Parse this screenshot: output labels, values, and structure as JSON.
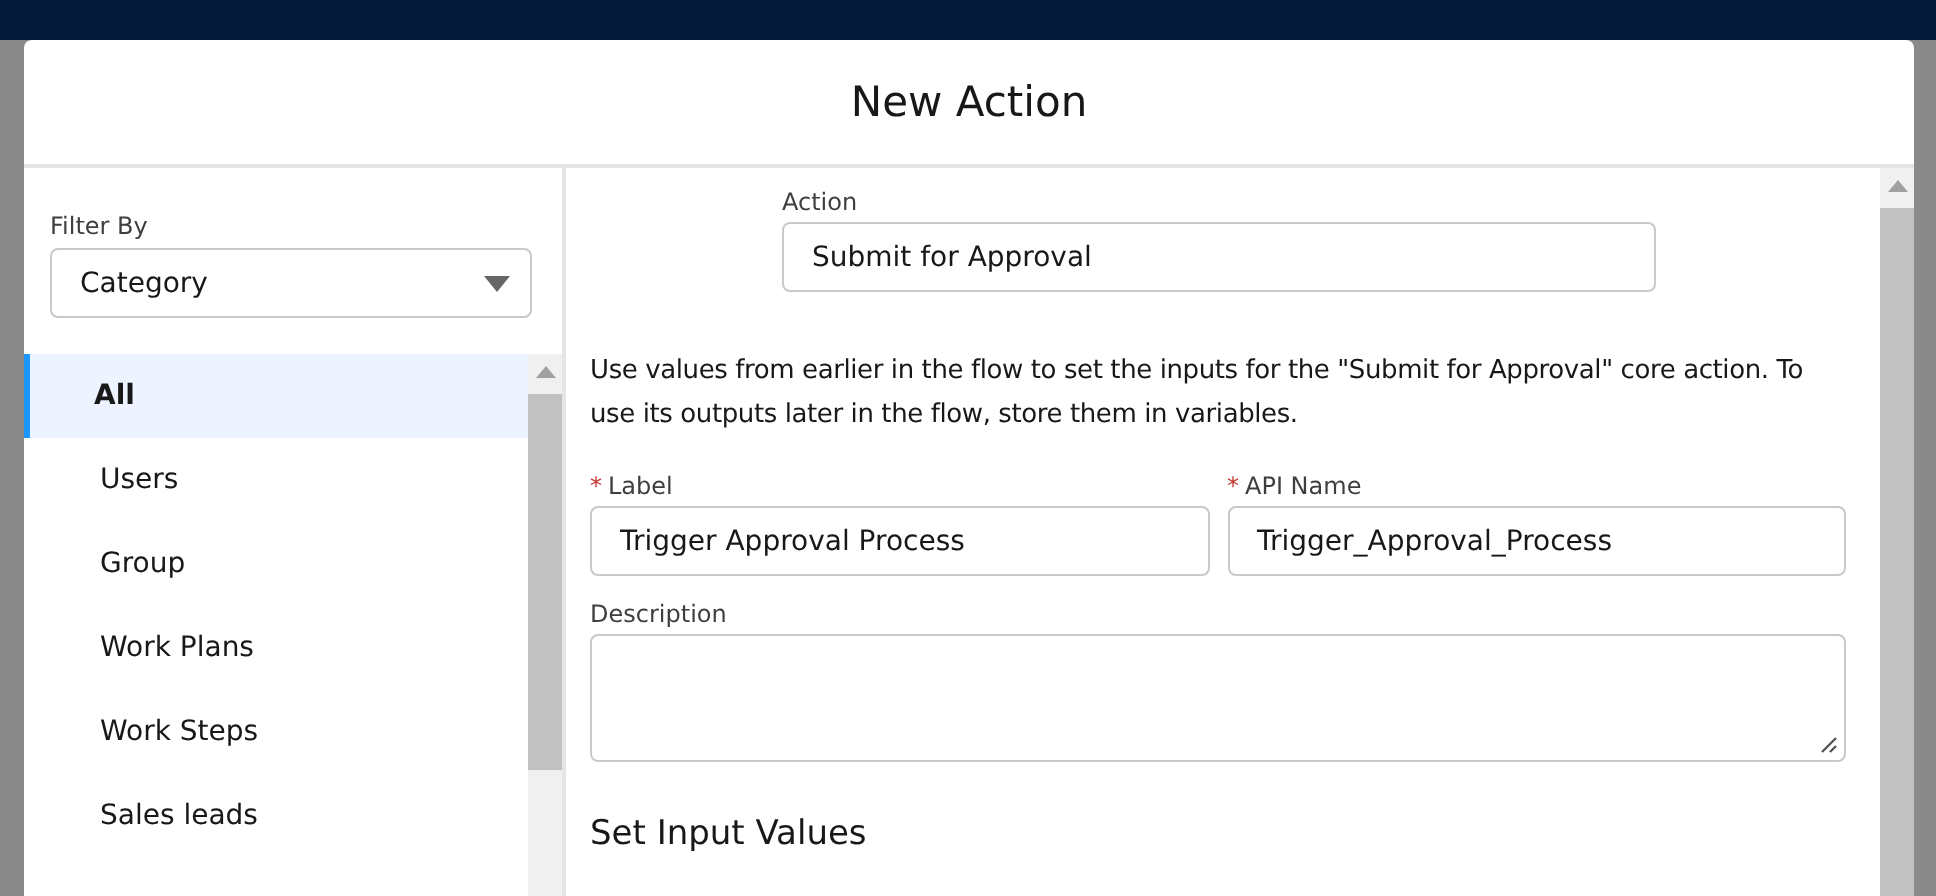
{
  "modal": {
    "title": "New Action"
  },
  "filter": {
    "label": "Filter By",
    "value": "Category"
  },
  "categories": [
    {
      "label": "All",
      "selected": true
    },
    {
      "label": "Users",
      "selected": false
    },
    {
      "label": "Group",
      "selected": false
    },
    {
      "label": "Work Plans",
      "selected": false
    },
    {
      "label": "Work Steps",
      "selected": false
    },
    {
      "label": "Sales leads",
      "selected": false
    }
  ],
  "action": {
    "label": "Action",
    "value": "Submit for Approval"
  },
  "intro": "Use values from earlier in the flow to set the inputs for the \"Submit for Approval\" core action. To use its outputs later in the flow, store them in variables.",
  "fields": [
    {
      "marker": "*",
      "label": "Label",
      "value": "Trigger Approval Process"
    },
    {
      "marker": "*",
      "label": "API Name",
      "value": "Trigger_Approval_Process"
    }
  ],
  "description": {
    "label": "Description"
  },
  "section_heading": "Set Input Values"
}
